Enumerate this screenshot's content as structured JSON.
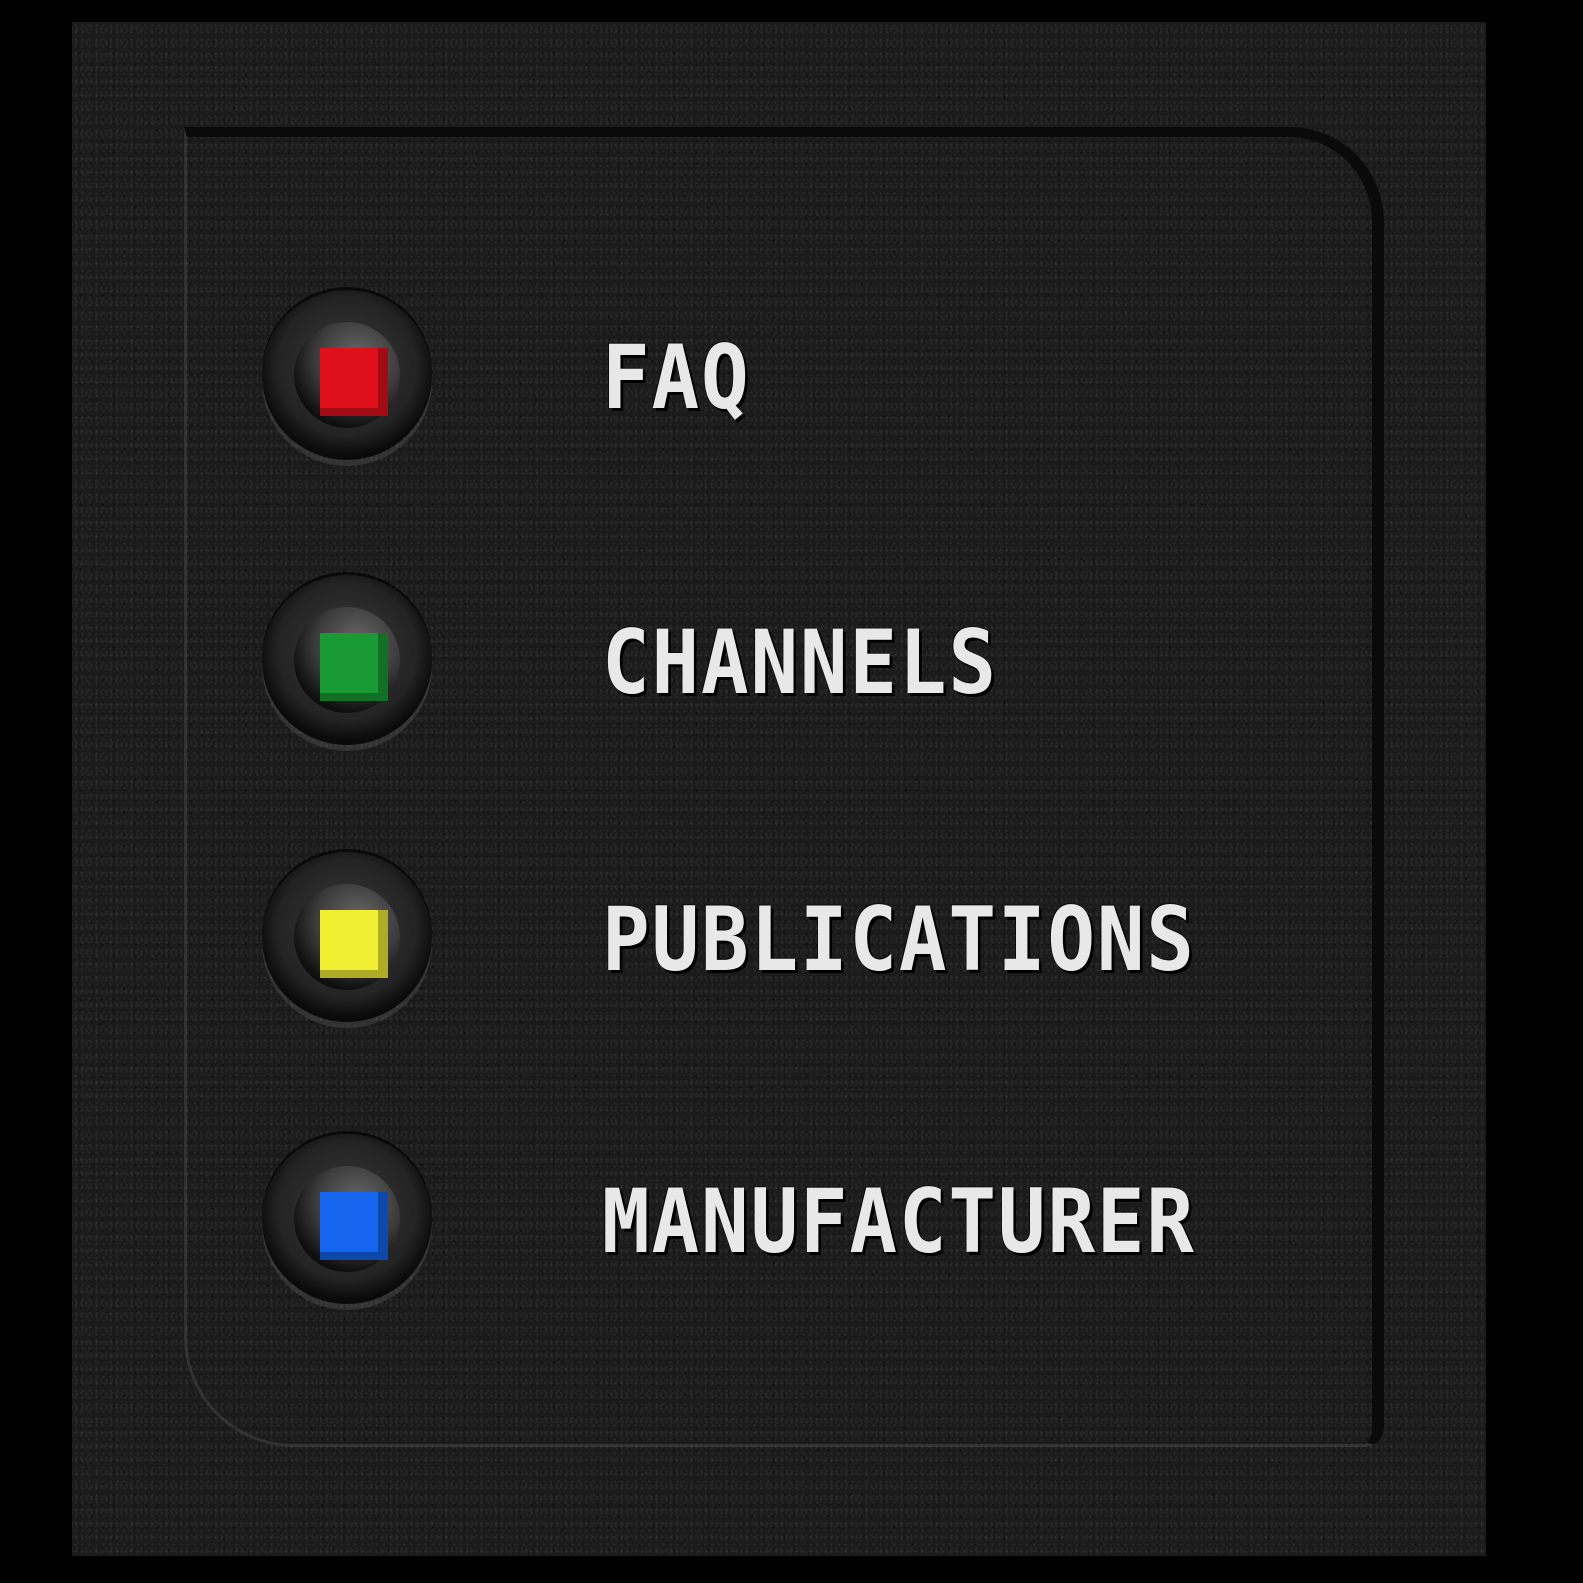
{
  "menu": {
    "items": [
      {
        "label": "FAQ",
        "color": "#e0101b",
        "icon": "red-square-led-icon"
      },
      {
        "label": "CHANNELS",
        "color": "#1a9a34",
        "icon": "green-square-led-icon"
      },
      {
        "label": "PUBLICATIONS",
        "color": "#f2ee32",
        "icon": "yellow-square-led-icon"
      },
      {
        "label": "MANUFACTURER",
        "color": "#1565ee",
        "icon": "blue-square-led-icon"
      }
    ]
  }
}
